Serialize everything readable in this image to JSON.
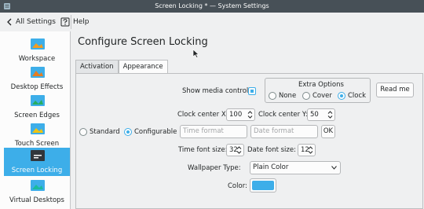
{
  "window": {
    "title": "Screen Locking * — System Settings"
  },
  "toolbar": {
    "back_label": "All Settings",
    "help_label": "Help"
  },
  "sidebar": {
    "items": [
      {
        "label": "Workspace",
        "color": "#3daee9"
      },
      {
        "label": "Desktop Effects",
        "color": "#e67e22"
      },
      {
        "label": "Screen Edges",
        "color": "#27ae60"
      },
      {
        "label": "Touch Screen",
        "color": "#f1c40f"
      },
      {
        "label": "Screen Locking",
        "color": "#31363b"
      },
      {
        "label": "Virtual Desktops",
        "color": "#3498db"
      }
    ],
    "active_index": 4
  },
  "main": {
    "heading": "Configure Screen Locking",
    "tabs": [
      {
        "label": "Activation"
      },
      {
        "label": "Appearance"
      }
    ],
    "active_tab": 1
  },
  "form": {
    "show_media_controls_label": "Show media controls:",
    "extra_options": {
      "title": "Extra Options",
      "options": [
        "None",
        "Cover",
        "Clock"
      ],
      "selected": "Clock"
    },
    "read_me_label": "Read me",
    "clock_center_x_label": "Clock center X:",
    "clock_center_x_value": "100",
    "clock_center_y_label": "Clock center Y:",
    "clock_center_y_value": "50",
    "mode": {
      "standard_label": "Standard",
      "configurable_label": "Configurable",
      "selected": "Configurable"
    },
    "time_format_placeholder": "Time format",
    "date_format_placeholder": "Date format",
    "ok_label": "OK",
    "time_font_size_label": "Time font size:",
    "time_font_size_value": "32",
    "date_font_size_label": "Date font size:",
    "date_font_size_value": "12",
    "wallpaper_type_label": "Wallpaper Type:",
    "wallpaper_type_value": "Plain Color",
    "color_label": "Color:",
    "color_value": "#3daee9"
  }
}
